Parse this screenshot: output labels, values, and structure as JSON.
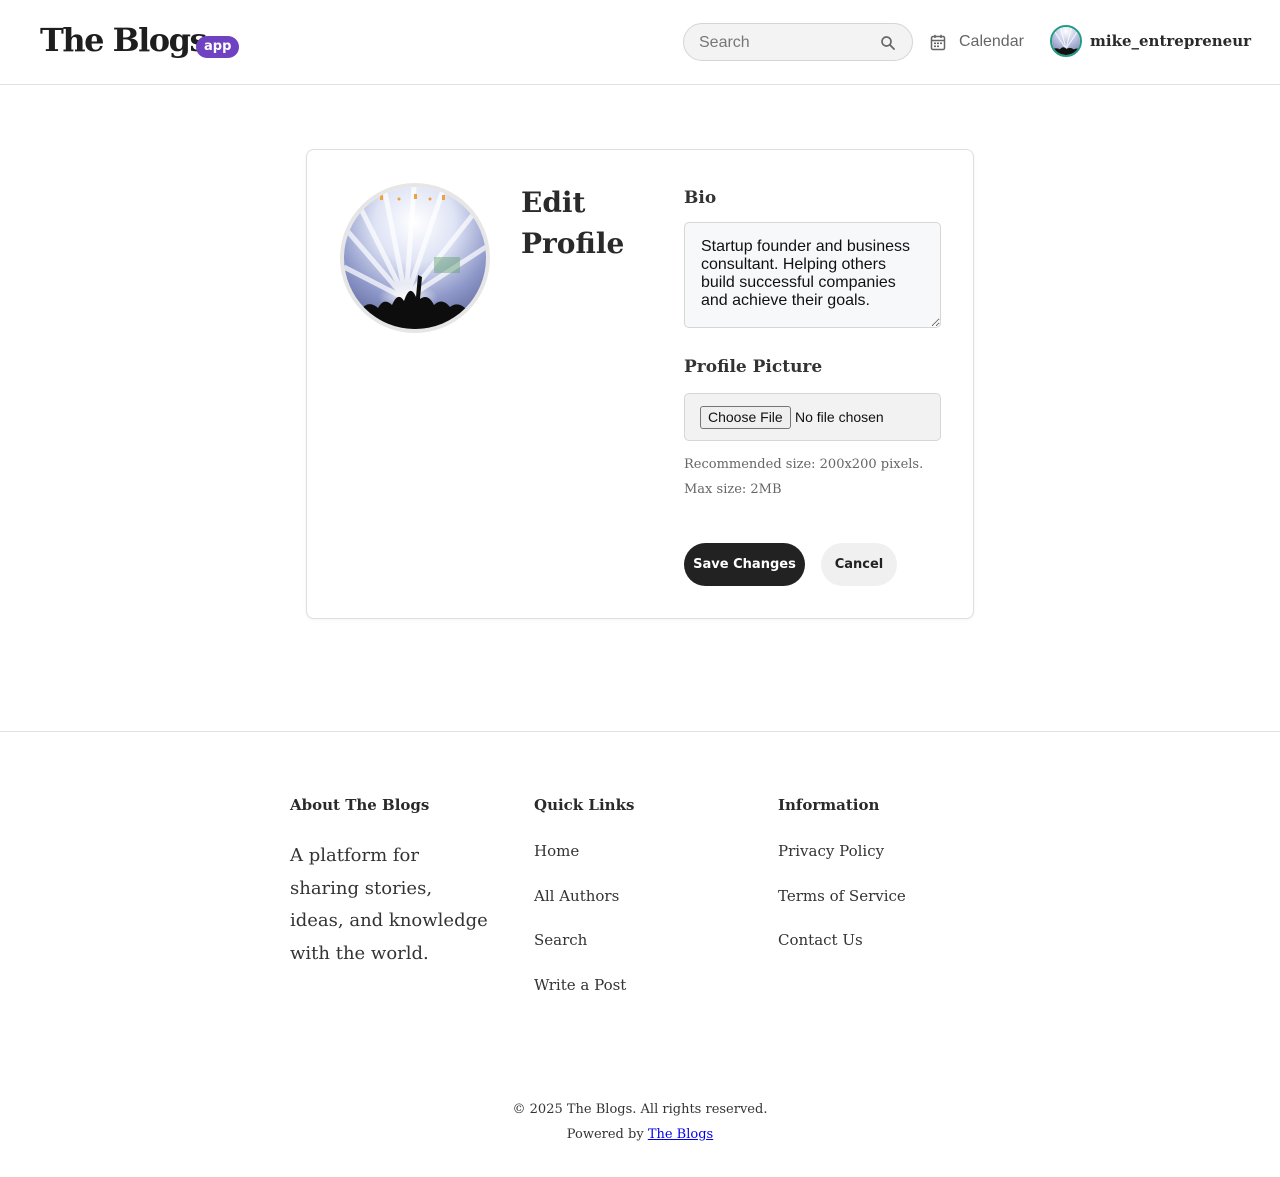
{
  "header": {
    "logo_text": "The Blogs",
    "logo_badge": "app",
    "search_placeholder": "Search",
    "calendar_label": "Calendar",
    "username": "mike_entrepreneur"
  },
  "edit_profile": {
    "title": "Edit Profile",
    "bio_label": "Bio",
    "bio_value": "Startup founder and business consultant. Helping others build successful companies and achieve their goals.",
    "picture_label": "Profile Picture",
    "choose_file_label": "Choose File",
    "file_status": "No file chosen",
    "hint": "Recommended size: 200x200 pixels. Max size: 2MB",
    "save_label": "Save Changes",
    "cancel_label": "Cancel"
  },
  "footer": {
    "about_heading": "About The Blogs",
    "about_text": "A platform for sharing stories, ideas, and knowledge with the world.",
    "quick_links_heading": "Quick Links",
    "quick_links": [
      "Home",
      "All Authors",
      "Search",
      "Write a Post"
    ],
    "information_heading": "Information",
    "information_links": [
      "Privacy Policy",
      "Terms of Service",
      "Contact Us"
    ],
    "copyright": "© 2025 The Blogs. All rights reserved.",
    "powered_by": "Powered by",
    "powered_by_link": "The Blogs"
  },
  "colors": {
    "badge": "#6f42c1",
    "primary_button": "#222222",
    "avatar_ring": "#1f9d82"
  },
  "icons": [
    "search-icon",
    "calendar-icon"
  ]
}
